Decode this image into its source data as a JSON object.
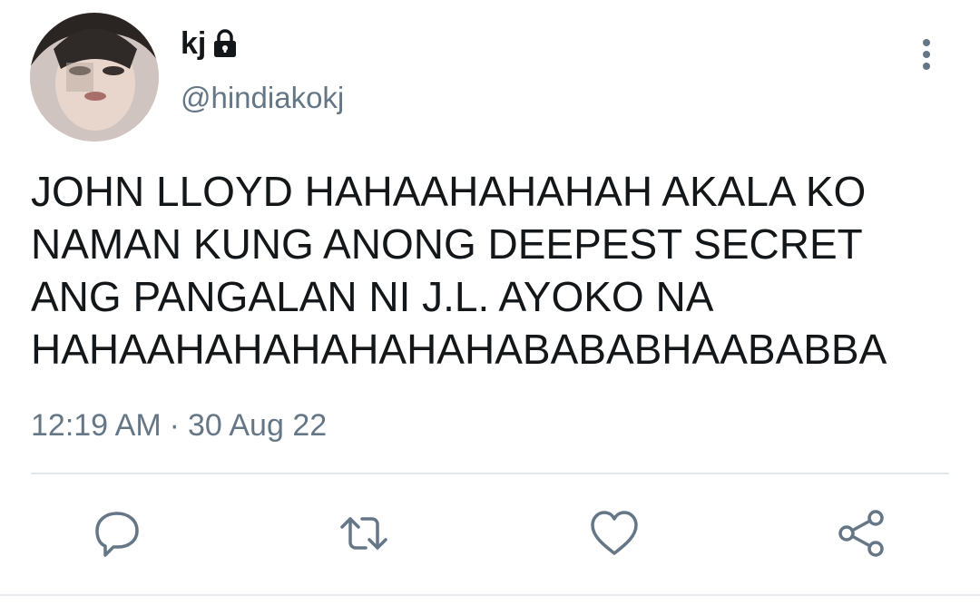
{
  "author": {
    "display_name": "kj",
    "handle": "@hindiakokj",
    "protected": true
  },
  "tweet": {
    "text": "JOHN LLOYD HAHAAHAHAHAH AKALA KO\nNAMAN KUNG ANONG DEEPEST SECRET\nANG PANGALAN NI J.L. AYOKO NA\nHAHAAHAHAHAHAHAHABABABHAABABBA",
    "time": "12:19 AM",
    "separator": "·",
    "date": "30 Aug 22"
  },
  "icons": {
    "lock": "lock-icon",
    "more": "more-vertical-icon",
    "reply": "reply-icon",
    "retweet": "retweet-icon",
    "like": "heart-icon",
    "share": "share-icon"
  },
  "colors": {
    "text": "#14171a",
    "secondary": "#657786",
    "icon": "#657786",
    "divider": "#e1e8ed"
  }
}
